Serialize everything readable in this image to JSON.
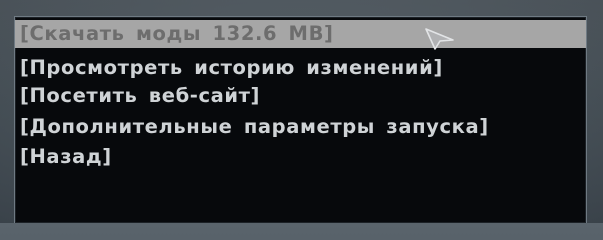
{
  "menu": {
    "items": [
      {
        "label": "[Скачать моды 132.6 MB]",
        "selected": true
      },
      {
        "label": "[Просмотреть историю изменений]",
        "selected": false
      },
      {
        "label": "[Посетить веб-сайт]",
        "selected": false
      },
      {
        "label": "[Дополнительные параметры запуска]",
        "selected": false
      },
      {
        "label": "[Назад]",
        "selected": false
      }
    ]
  },
  "colors": {
    "panel_background": "#07090c",
    "text": "#cfd3d6",
    "selected_background": "#a6a6a6",
    "selected_text": "#6d6d6d"
  },
  "cursor_icon": "arrow-cursor-icon"
}
